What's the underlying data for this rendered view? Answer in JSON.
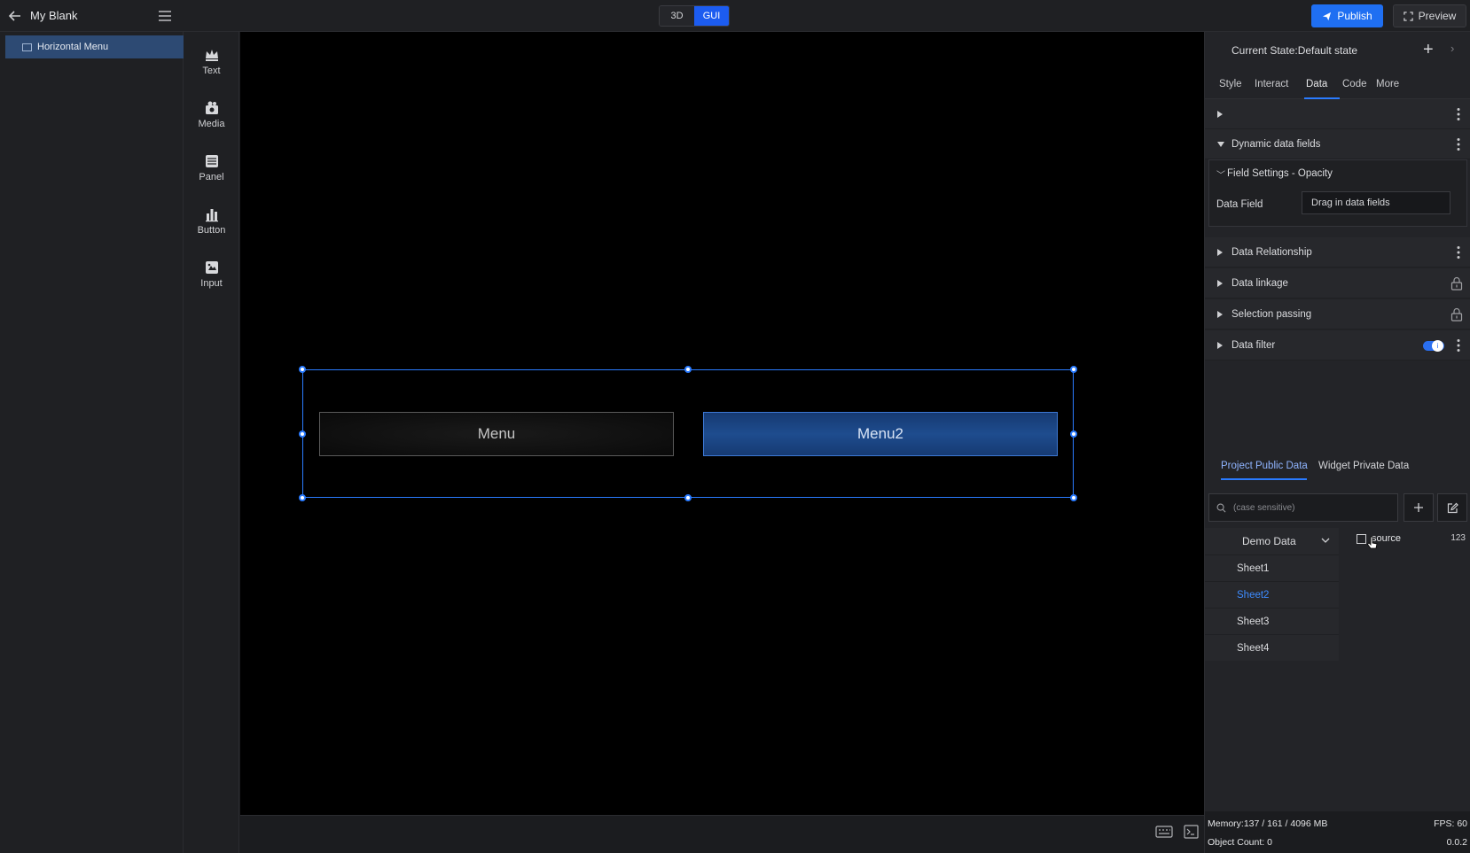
{
  "topbar": {
    "title": "My Blank",
    "modes": [
      {
        "label": "3D",
        "active": false
      },
      {
        "label": "GUI",
        "active": true
      }
    ],
    "publish_label": "Publish",
    "preview_label": "Preview"
  },
  "layers": {
    "items": [
      {
        "label": "Horizontal Menu",
        "selected": true
      }
    ]
  },
  "components": [
    {
      "label": "Text",
      "icon": "text-crown-icon"
    },
    {
      "label": "Media",
      "icon": "media-icon"
    },
    {
      "label": "Panel",
      "icon": "panel-icon"
    },
    {
      "label": "Button",
      "icon": "bar-chart-icon"
    },
    {
      "label": "Input",
      "icon": "input-icon"
    }
  ],
  "canvas": {
    "menu_items": [
      {
        "label": "Menu",
        "active": false
      },
      {
        "label": "Menu2",
        "active": true
      }
    ]
  },
  "right_panel": {
    "state_title": "Current State:Default state",
    "tabs": [
      {
        "label": "Style"
      },
      {
        "label": "Interact"
      },
      {
        "label": "Data",
        "active": true
      },
      {
        "label": "Code"
      },
      {
        "label": "More"
      }
    ],
    "sections": {
      "dynamic_fields": "Dynamic data fields",
      "field_settings_title": "Field Settings - Opacity",
      "data_field_label": "Data Field",
      "data_field_placeholder": "Drag in data fields",
      "data_relationship": "Data Relationship",
      "data_linkage": "Data linkage",
      "selection_passing": "Selection passing",
      "data_filter": "Data filter",
      "data_filter_enabled": true
    },
    "data_tabs": [
      {
        "label": "Project Public Data",
        "active": true
      },
      {
        "label": "Widget Private Data",
        "active": false
      }
    ],
    "search_placeholder": "(case sensitive)",
    "datasource": {
      "name": "Demo Data",
      "sheets": [
        {
          "label": "Sheet1",
          "active": false
        },
        {
          "label": "Sheet2",
          "active": true
        },
        {
          "label": "Sheet3",
          "active": false
        },
        {
          "label": "Sheet4",
          "active": false
        }
      ]
    },
    "fields": [
      {
        "name": "source",
        "type": "123"
      }
    ],
    "status": {
      "memory": "Memory:137 / 161 / 4096 MB",
      "fps": "FPS: 60",
      "objects": "Object Count: 0",
      "version": "0.0.2"
    }
  },
  "colors": {
    "accent": "#1f6ff2",
    "selection": "#2a7bff",
    "active_sheet": "#3d8bff"
  }
}
